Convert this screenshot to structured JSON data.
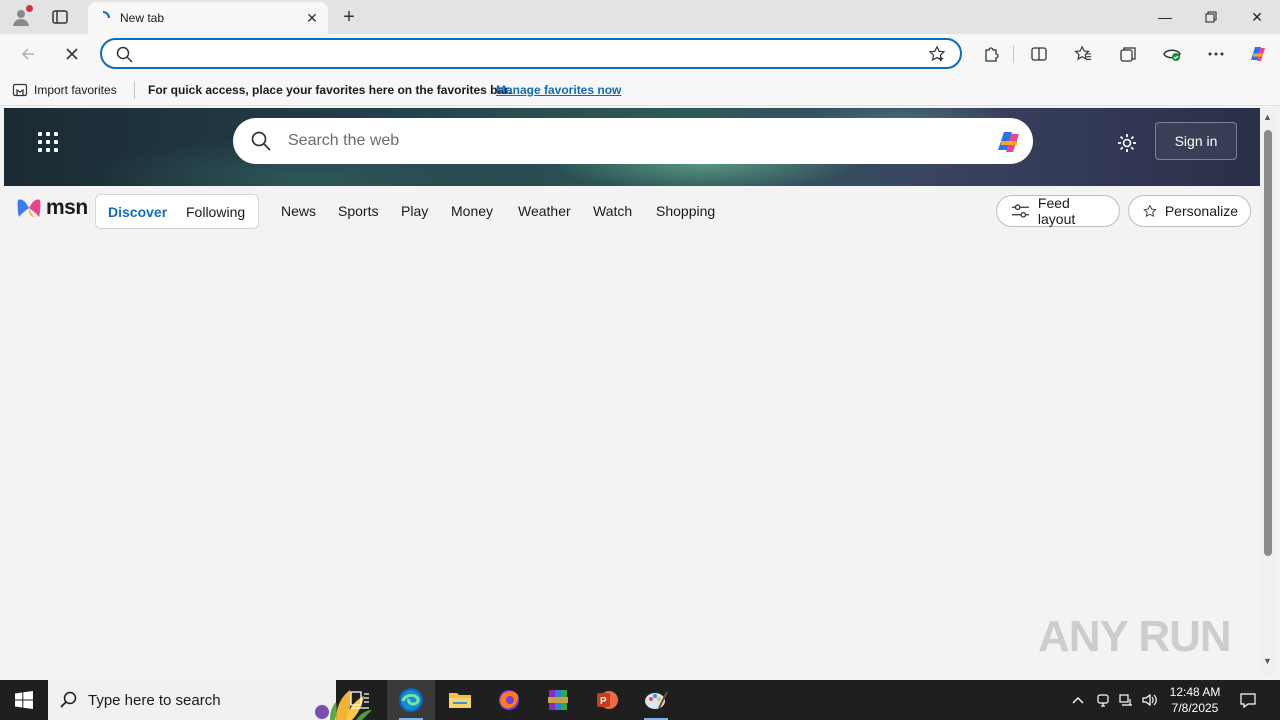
{
  "browser": {
    "tab_title": "New tab",
    "address_value": "",
    "favorites_bar": {
      "import_label": "Import favorites",
      "message": "For quick access, place your favorites here on the favorites bar.",
      "link": "Manage favorites now"
    }
  },
  "msn": {
    "search_placeholder": "Search the web",
    "sign_in": "Sign in",
    "logo_text": "msn",
    "feed_tabs": {
      "discover": "Discover",
      "following": "Following"
    },
    "nav": [
      "News",
      "Sports",
      "Play",
      "Money",
      "Weather",
      "Watch",
      "Shopping"
    ],
    "feed_layout": "Feed layout",
    "personalize": "Personalize"
  },
  "watermark": "ANY RUN",
  "taskbar": {
    "search_placeholder": "Type here to search",
    "time": "12:48 AM",
    "date": "7/8/2025"
  },
  "colors": {
    "accent": "#0f6cbd",
    "taskbar": "#1f1f1f"
  }
}
